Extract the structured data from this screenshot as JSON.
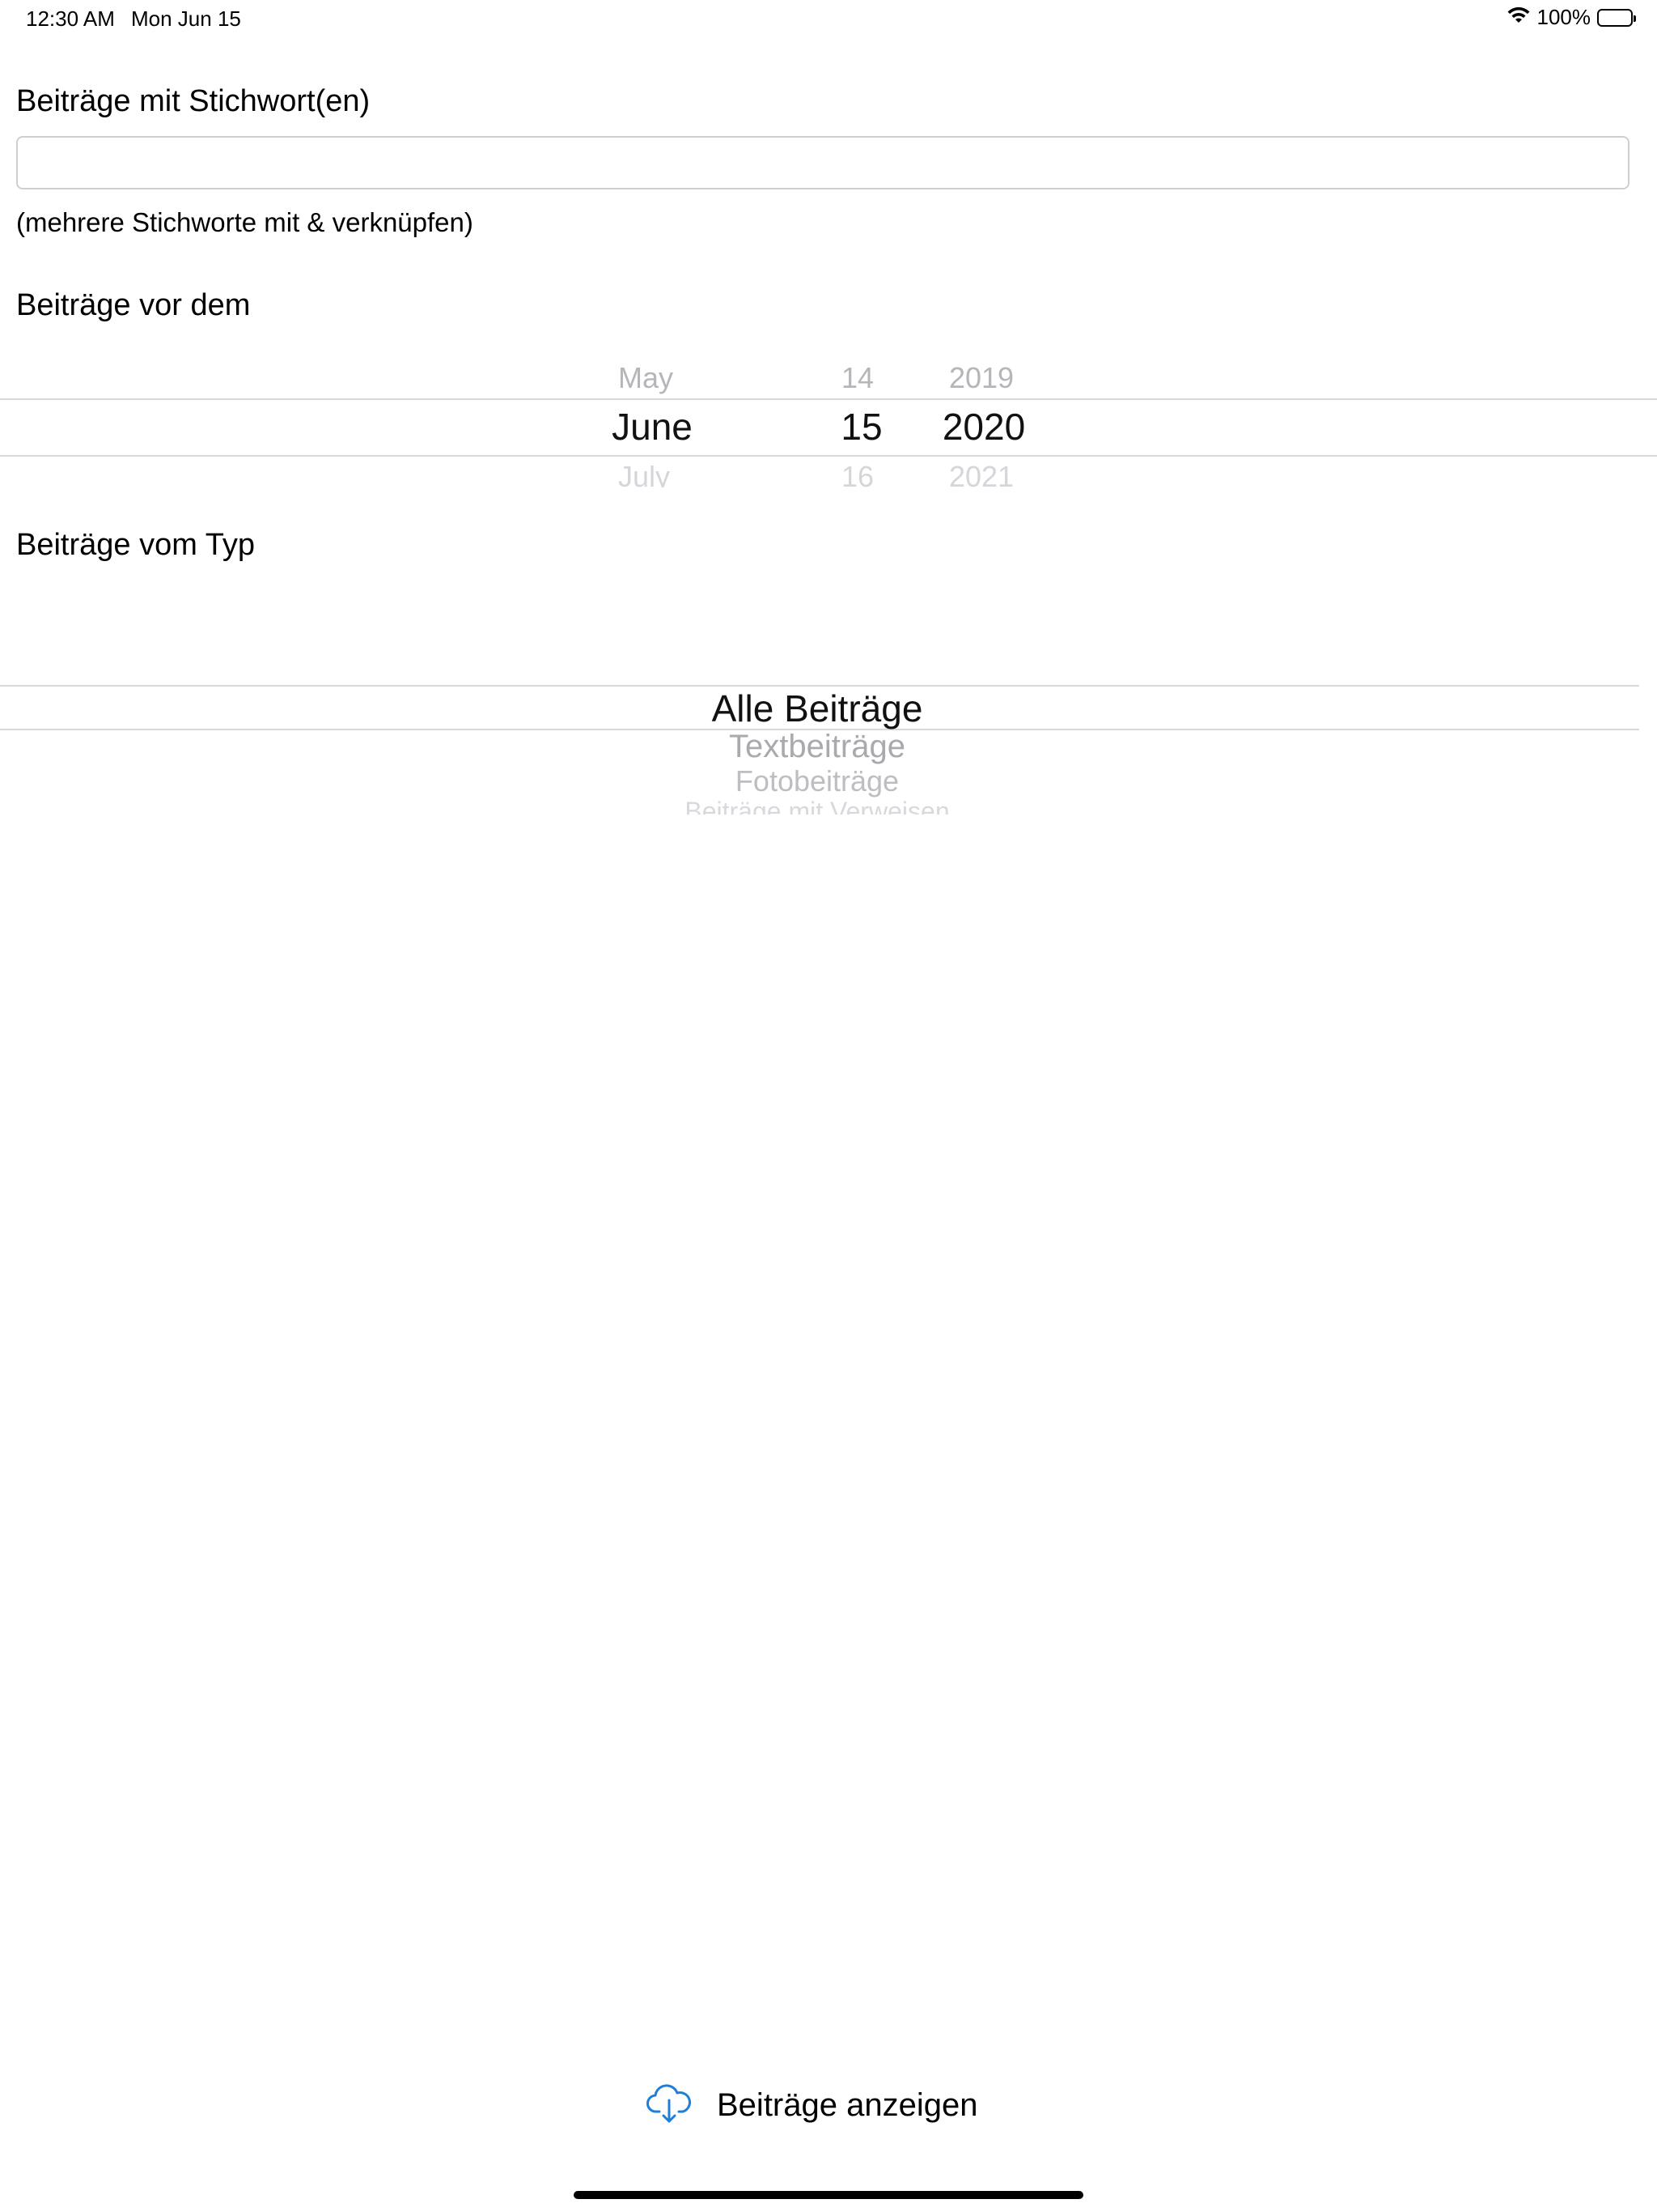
{
  "status_bar": {
    "time": "12:30 AM",
    "date": "Mon Jun 15",
    "battery": "100%"
  },
  "keywords": {
    "label": "Beiträge mit Stichwort(en)",
    "value": "",
    "hint": "(mehrere Stichworte mit & verknüpfen)"
  },
  "date_picker": {
    "label": "Beiträge vor dem",
    "months": {
      "prev": "May",
      "selected": "June",
      "next": "July"
    },
    "days": {
      "prev": "14",
      "selected": "15",
      "next": "16"
    },
    "years": {
      "prev": "2019",
      "selected": "2020",
      "next": "2021"
    }
  },
  "type_picker": {
    "label": "Beiträge vom Typ",
    "selected": "Alle Beiträge",
    "options": [
      "Alle Beiträge",
      "Textbeiträge",
      "Fotobeiträge",
      "Beiträge mit Verweisen"
    ]
  },
  "action": {
    "label": "Beiträge anzeigen",
    "icon": "cloud-download-icon",
    "color": "#1e7fd9"
  }
}
